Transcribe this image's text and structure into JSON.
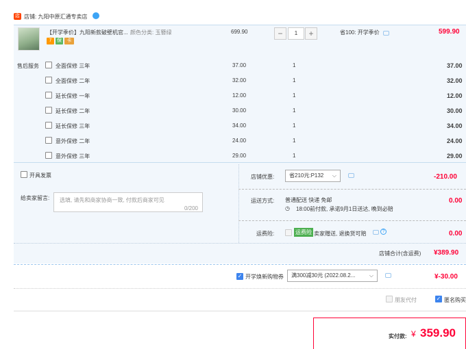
{
  "shop": {
    "label": "店铺: 九阳中原汇通专卖店"
  },
  "item": {
    "title": "【开学季价】九阳新款破壁机官...",
    "sku": "颜色分类: 玉簪绿",
    "unit_price": "699.90",
    "quantity": "1",
    "promo": "省100: 开学季价",
    "total": "599.90",
    "badges": [
      "7",
      "保",
      "卡"
    ]
  },
  "service": {
    "label": "售后服务",
    "options": [
      {
        "name": "全面保修 三年",
        "price": "37.00",
        "qty": "1",
        "total": "37.00"
      },
      {
        "name": "全面保修 二年",
        "price": "32.00",
        "qty": "1",
        "total": "32.00"
      },
      {
        "name": "延长保修 一年",
        "price": "12.00",
        "qty": "1",
        "total": "12.00"
      },
      {
        "name": "延长保修 二年",
        "price": "30.00",
        "qty": "1",
        "total": "30.00"
      },
      {
        "name": "延长保修 三年",
        "price": "34.00",
        "qty": "1",
        "total": "34.00"
      },
      {
        "name": "意外保修 二年",
        "price": "24.00",
        "qty": "1",
        "total": "24.00"
      },
      {
        "name": "意外保修 三年",
        "price": "29.00",
        "qty": "1",
        "total": "29.00"
      }
    ]
  },
  "invoice": {
    "label": "开具发票"
  },
  "message": {
    "label": "给卖家留言:",
    "placeholder": "选填, 请先和商家协商一致, 付款后商家可见",
    "counter": "0/200"
  },
  "shop_coupon": {
    "label": "店铺优惠:",
    "value": "省210元:P132",
    "amount": "-210.00"
  },
  "shipping": {
    "label": "运送方式:",
    "method": "普通配送 快递 免邮",
    "note": "18:00前付款, 承诺9月1日送达, 晚到必赔",
    "amount": "0.00"
  },
  "insurance": {
    "label": "运费险:",
    "tag": "运费险",
    "desc": "卖家赠送, 退换货可赔",
    "amount": "0.00"
  },
  "shop_total": {
    "label": "店铺合计(含运费)",
    "amount": "¥389.90"
  },
  "coupon": {
    "label": "开学焕新购物券",
    "value": "满300减30元 (2022.08.2...",
    "amount": "¥-30.00"
  },
  "options": {
    "friend_pay": "朋友代付",
    "anonymous": "匿名购买"
  },
  "pay": {
    "label": "实付款:",
    "currency": "¥",
    "amount": "359.90"
  },
  "colors": {
    "accent": "#ff0036",
    "panel": "#f2f7fc",
    "check": "#3d84ee"
  }
}
